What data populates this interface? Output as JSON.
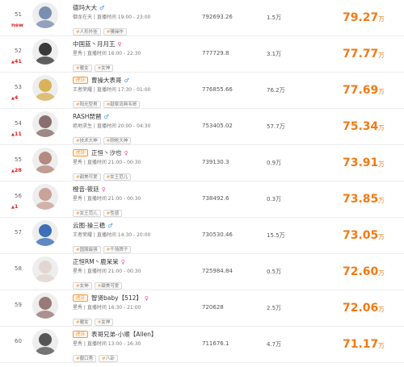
{
  "colors": {
    "accent": "#f27a14",
    "up": "#e0201e",
    "down": "#27a844",
    "male": "#3b8ee6",
    "female": "#f0509a"
  },
  "heat_unit": "万",
  "rows": [
    {
      "rank": "51",
      "change": "new",
      "change_type": "new",
      "badge": "",
      "name": "德玛大大",
      "gender": "male",
      "gender_icon": "♂",
      "category": "御龙在天",
      "live_label": "直播时间",
      "time": "19:00 - 23:00",
      "tags": [
        "人形外挂",
        "骚操作"
      ],
      "score": "792693.26",
      "fans": "1.5万",
      "heat": "79.27",
      "avatar_color": "#7a8fb0"
    },
    {
      "rank": "52",
      "change": "41",
      "change_type": "up",
      "badge": "",
      "name": "中国蓝丶月月王",
      "gender": "female",
      "gender_icon": "♀",
      "category": "星秀",
      "live_label": "直播时间",
      "time": "16:00 - 22:30",
      "tags": [
        "暖女",
        "女神"
      ],
      "score": "777729.8",
      "fans": "3.1万",
      "heat": "77.77",
      "avatar_color": "#3a3a3a"
    },
    {
      "rank": "53",
      "change": "4",
      "change_type": "up",
      "badge": "虎牙",
      "name": "曹操大表哥",
      "gender": "male",
      "gender_icon": "♂",
      "category": "王者荣耀",
      "live_label": "直播时间",
      "time": "17:30 - 01:00",
      "tags": [
        "阳光型男",
        "献祭流典韦哥"
      ],
      "score": "776855.66",
      "fans": "76.2万",
      "heat": "77.69",
      "avatar_color": "#d9b25a"
    },
    {
      "rank": "54",
      "change": "11",
      "change_type": "up",
      "badge": "",
      "name": "RASH琵琶",
      "gender": "male",
      "gender_icon": "♂",
      "category": "绝地求生",
      "live_label": "直播时间",
      "time": "20:00 - 04:30",
      "tags": [
        "技术大神",
        "刚枪大神"
      ],
      "score": "753405.02",
      "fans": "57.7万",
      "heat": "75.34",
      "avatar_color": "#8a6e6e"
    },
    {
      "rank": "55",
      "change": "28",
      "change_type": "up",
      "badge": "虎牙",
      "name": "正恒丶汐也",
      "gender": "female",
      "gender_icon": "♀",
      "category": "星秀",
      "live_label": "直播时间",
      "time": "21:00 - 00:30",
      "tags": [
        "甜美可爱",
        "女王范儿"
      ],
      "score": "739130.3",
      "fans": "0.9万",
      "heat": "73.91",
      "avatar_color": "#b48a80"
    },
    {
      "rank": "56",
      "change": "1",
      "change_type": "up",
      "badge": "",
      "name": "橙音-筱廷",
      "gender": "female",
      "gender_icon": "♀",
      "category": "星秀",
      "live_label": "直播时间",
      "time": "21:00 - 00:30",
      "tags": [
        "女王范儿",
        "性感"
      ],
      "score": "738492.6",
      "fans": "0.3万",
      "heat": "73.85",
      "avatar_color": "#c9a29a"
    },
    {
      "rank": "57",
      "change": "",
      "change_type": "none",
      "badge": "",
      "name": "云图-操三稳",
      "gender": "male",
      "gender_icon": "♂",
      "category": "王者荣耀",
      "live_label": "直播时间",
      "time": "14:30 - 20:00",
      "tags": [
        "国服最强",
        "千场牌子"
      ],
      "score": "730530.46",
      "fans": "15.5万",
      "heat": "73.05",
      "avatar_color": "#3c6fb8"
    },
    {
      "rank": "58",
      "change": "",
      "change_type": "none",
      "badge": "",
      "name": "正恒RM丶鹿呆呆",
      "gender": "female",
      "gender_icon": "♀",
      "category": "星秀",
      "live_label": "直播时间",
      "time": "21:00 - 00:30",
      "tags": [
        "女神",
        "甜美可爱"
      ],
      "score": "725984.84",
      "fans": "0.5万",
      "heat": "72.60",
      "avatar_color": "#e2d6d0"
    },
    {
      "rank": "59",
      "change": "",
      "change_type": "none",
      "badge": "虎牙",
      "name": "智贤baby【512】",
      "gender": "female",
      "gender_icon": "♀",
      "category": "星秀",
      "live_label": "直播时间",
      "time": "16:30 - 21:00",
      "tags": [
        "暖女",
        "女神"
      ],
      "score": "720628",
      "fans": "2.5万",
      "heat": "72.06",
      "avatar_color": "#9a7a78"
    },
    {
      "rank": "60",
      "change": "",
      "change_type": "none",
      "badge": "虎牙",
      "name": "表哥兄弟-小顺【Allen】",
      "gender": "",
      "gender_icon": "",
      "category": "星秀",
      "live_label": "直播时间",
      "time": "13:00 - 16:30",
      "tags": [
        "靓口秀",
        "八卦"
      ],
      "score": "711676.1",
      "fans": "4.7万",
      "heat": "71.17",
      "avatar_color": "#555555"
    }
  ]
}
